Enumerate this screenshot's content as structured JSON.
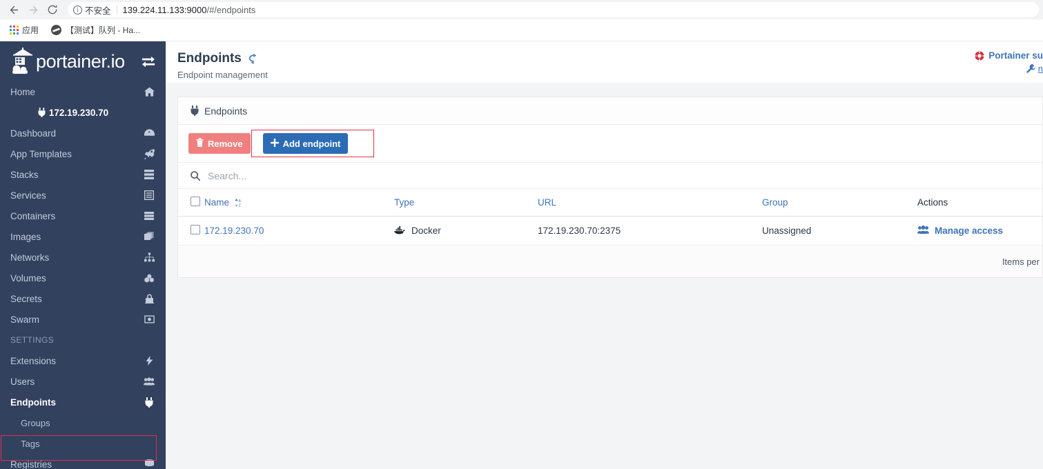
{
  "browser": {
    "back_icon": "back-arrow-icon",
    "forward_icon": "forward-arrow-icon",
    "reload_icon": "reload-icon",
    "security_label": "不安全",
    "url_host": "139.224.11.133:9000",
    "url_path": "/#/endpoints",
    "bookmarks": [
      {
        "label": "应用",
        "icon": "apps-grid-icon"
      },
      {
        "label": "【测试】队列 - Ha...",
        "icon": "globe-icon"
      }
    ]
  },
  "sidebar": {
    "logo_text": "portainer.io",
    "toggle_icon": "exchange-arrows-icon",
    "active_endpoint": "172.19.230.70",
    "items": [
      {
        "label": "Home",
        "icon": "home-icon"
      },
      {
        "label": "Dashboard",
        "icon": "dashboard-icon"
      },
      {
        "label": "App Templates",
        "icon": "rocket-icon"
      },
      {
        "label": "Stacks",
        "icon": "stacks-icon"
      },
      {
        "label": "Services",
        "icon": "services-icon"
      },
      {
        "label": "Containers",
        "icon": "containers-icon"
      },
      {
        "label": "Images",
        "icon": "images-icon"
      },
      {
        "label": "Networks",
        "icon": "networks-icon"
      },
      {
        "label": "Volumes",
        "icon": "volumes-icon"
      },
      {
        "label": "Secrets",
        "icon": "secrets-icon"
      },
      {
        "label": "Swarm",
        "icon": "swarm-icon"
      }
    ],
    "settings_section": "SETTINGS",
    "settings_items": [
      {
        "label": "Extensions",
        "icon": "bolt-icon",
        "sub": false,
        "current": false
      },
      {
        "label": "Users",
        "icon": "users-icon",
        "sub": false,
        "current": false
      },
      {
        "label": "Endpoints",
        "icon": "plug-icon",
        "sub": false,
        "current": true
      },
      {
        "label": "Groups",
        "icon": "",
        "sub": true,
        "current": false
      },
      {
        "label": "Tags",
        "icon": "",
        "sub": true,
        "current": false
      },
      {
        "label": "Registries",
        "icon": "registries-icon",
        "sub": false,
        "current": false
      }
    ]
  },
  "header": {
    "title": "Endpoints",
    "refresh_icon": "refresh-icon",
    "subtitle": "Endpoint management",
    "support_label": "Portainer su",
    "support_icon": "lifebuoy-icon",
    "settings_label": "n",
    "settings_icon": "wrench-icon"
  },
  "panel": {
    "heading": "Endpoints",
    "heading_icon": "plug-icon",
    "remove_label": "Remove",
    "remove_icon": "trash-icon",
    "add_label": "Add endpoint",
    "add_icon": "plus-icon",
    "search_placeholder": "Search...",
    "search_value": "",
    "search_icon": "search-icon",
    "footer_label": "Items per"
  },
  "table": {
    "columns": [
      {
        "label": "Name",
        "link": true,
        "sort": true
      },
      {
        "label": "Type",
        "link": true,
        "sort": false
      },
      {
        "label": "URL",
        "link": true,
        "sort": false
      },
      {
        "label": "Group",
        "link": true,
        "sort": false
      },
      {
        "label": "Actions",
        "link": false,
        "sort": false
      }
    ],
    "rows": [
      {
        "name": "172.19.230.70",
        "type": "Docker",
        "type_icon": "docker-whale-icon",
        "url": "172.19.230.70:2375",
        "group": "Unassigned",
        "action_label": "Manage access",
        "action_icon": "users-group-icon"
      }
    ]
  },
  "annotations": {
    "highlight_color": "#e0314b",
    "boxes": [
      "add-endpoint-button",
      "sidebar-item-endpoints"
    ]
  },
  "colors": {
    "sidebar_bg": "#31415e",
    "accent_blue": "#3d74b8",
    "add_button": "#2b6cb5",
    "remove_button": "#f0807f",
    "page_bg": "#f3f4f5"
  }
}
